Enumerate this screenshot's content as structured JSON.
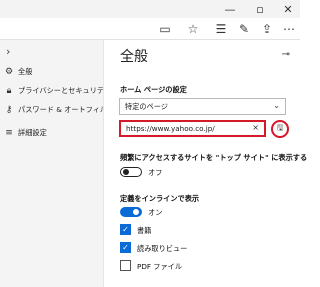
{
  "browser": {
    "toolbar_icons": {
      "tab_actions": "tab-actions-icon",
      "favorite": "star-icon",
      "favorites_bar": "favorites-icon",
      "pen": "pen-icon",
      "share": "share-icon",
      "more": "more-icon"
    }
  },
  "sidebar": {
    "items": [
      {
        "label": "全般",
        "icon": "gear-icon"
      },
      {
        "label": "プライバシーとセキュリティ",
        "icon": "lock-icon"
      },
      {
        "label": "パスワード & オートフィル",
        "icon": "key-icon"
      },
      {
        "label": "詳細設定",
        "icon": "sliders-icon"
      }
    ]
  },
  "panel": {
    "title": "全般",
    "home_page": {
      "label": "ホーム ページの設定",
      "select_value": "特定のページ",
      "url_value": "https://www.yahoo.co.jp/"
    },
    "top_sites": {
      "label": "頻繁にアクセスするサイトを \"トップ サイト\" に表示する",
      "state": "オフ"
    },
    "inline_definitions": {
      "label": "定義をインラインで表示",
      "state": "オン",
      "options": [
        {
          "label": "書籍",
          "checked": true
        },
        {
          "label": "読み取りビュー",
          "checked": true
        },
        {
          "label": "PDF ファイル",
          "checked": false
        }
      ]
    }
  },
  "colors": {
    "accent": "#0a6ad6",
    "highlight": "#d6182b"
  }
}
